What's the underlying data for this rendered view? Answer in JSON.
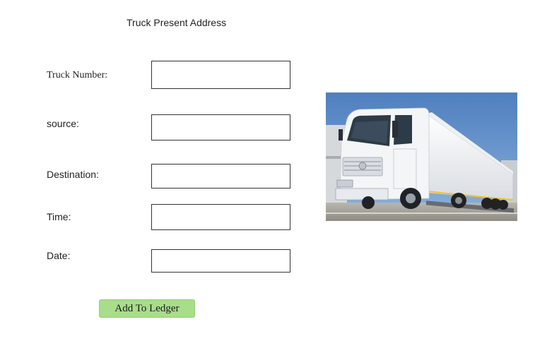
{
  "page": {
    "title": "Truck Present Address"
  },
  "form": {
    "fields": [
      {
        "label": "Truck Number:",
        "value": "",
        "placeholder": ""
      },
      {
        "label": "source:",
        "value": "",
        "placeholder": ""
      },
      {
        "label": "Destination:",
        "value": "",
        "placeholder": ""
      },
      {
        "label": "Time:",
        "value": "",
        "placeholder": ""
      },
      {
        "label": "Date:",
        "value": "",
        "placeholder": ""
      }
    ],
    "submit_label": "Add To Ledger"
  },
  "image": {
    "icon": "truck-photo"
  },
  "colors": {
    "button_bg": "#a8dd8a",
    "sky": "#5b8cc4",
    "truck_body": "#f3f5f7"
  }
}
